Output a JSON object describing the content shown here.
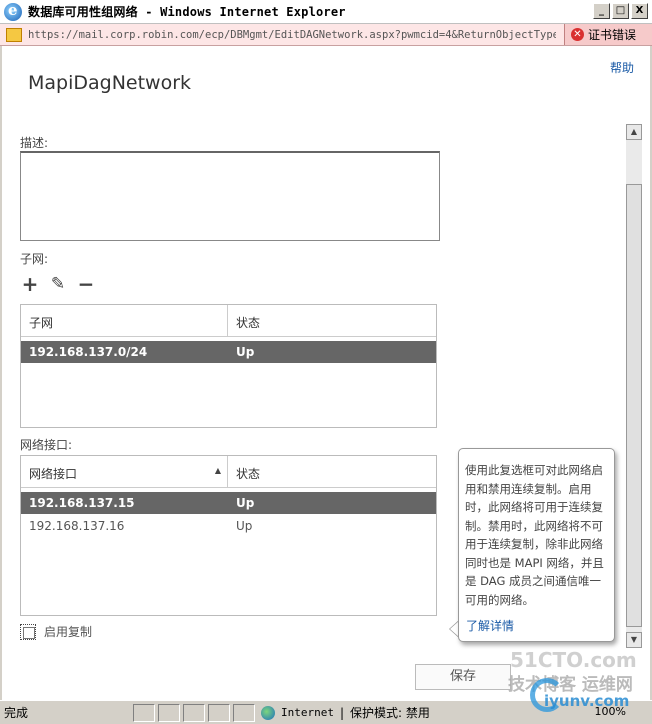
{
  "window": {
    "title": "数据库可用性组网络 - Windows Internet Explorer",
    "controls": {
      "minimize": "_",
      "maximize": "□",
      "close": "X"
    }
  },
  "address_bar": {
    "url": "https://mail.corp.robin.com/ecp/DBMgmt/EditDAGNetwork.aspx?pwmcid=4&ReturnObjectType=1&dt",
    "cert_error": "证书错误"
  },
  "page": {
    "help": "帮助",
    "title": "MapiDagNetwork",
    "description_label": "描述:",
    "subnets_label": "子网:",
    "toolbar": {
      "add": "+",
      "edit": "✎",
      "remove": "−"
    },
    "subnets_table": {
      "columns": [
        "子网",
        "状态"
      ],
      "rows": [
        {
          "subnet": "192.168.137.0/24",
          "status": "Up",
          "selected": true
        }
      ]
    },
    "interfaces_label": "网络接口:",
    "interfaces_table": {
      "columns": [
        "网络接口",
        "状态"
      ],
      "sort_indicator": "▲",
      "rows": [
        {
          "interface": "192.168.137.15",
          "status": "Up",
          "selected": true
        },
        {
          "interface": "192.168.137.16",
          "status": "Up",
          "selected": false
        }
      ]
    },
    "enable_replication": {
      "label": "启用复制",
      "checked": false
    },
    "callout": {
      "text": "使用此复选框可对此网络启用和禁用连续复制。启用时，此网络将可用于连续复制。禁用时，此网络将不可用于连续复制，除非此网络同时也是 MAPI 网络，并且是 DAG 成员之间通信唯一可用的网络。",
      "link": "了解详情"
    },
    "save_button": "保存",
    "scroll": {
      "up": "▲",
      "down": "▼"
    }
  },
  "status_bar": {
    "status": "完成",
    "zone": "Internet",
    "separator": "|",
    "protected_mode": "保护模式: 禁用",
    "zoom": "100%"
  },
  "watermark": {
    "line1": "51CTO.com",
    "line2": "技术博客 运维网",
    "line3": "iyunv.com"
  },
  "colors": {
    "selected_row": "#666666",
    "link": "#1a5aa6",
    "address_bar_error": "#fde6e6"
  }
}
